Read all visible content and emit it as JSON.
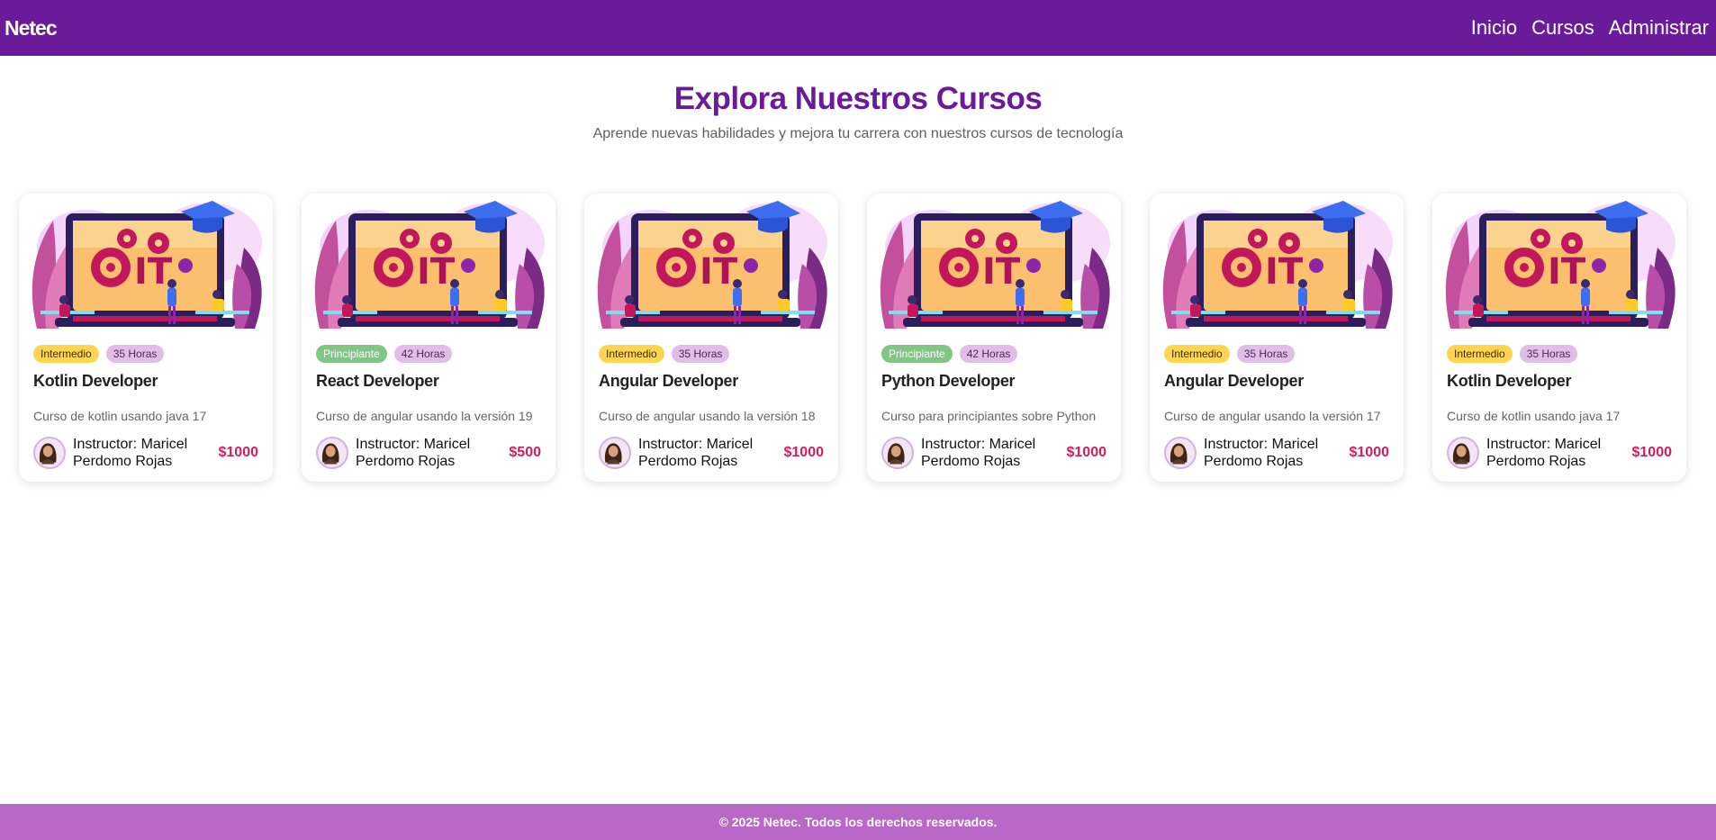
{
  "nav": {
    "brand": "Netec",
    "links": [
      "Inicio",
      "Cursos",
      "Administrar"
    ]
  },
  "hero": {
    "title": "Explora Nuestros Cursos",
    "subtitle": "Aprende nuevas habilidades y mejora tu carrera con nuestros cursos de tecnología"
  },
  "courses": [
    {
      "level": "Intermedio",
      "hours": "35 Horas",
      "title": "Kotlin Developer",
      "description": "Curso de kotlin usando java 17",
      "instructor": "Instructor: Maricel Perdomo Rojas",
      "price": "$1000"
    },
    {
      "level": "Principiante",
      "hours": "42 Horas",
      "title": "React Developer",
      "description": "Curso de angular usando la versión 19",
      "instructor": "Instructor: Maricel Perdomo Rojas",
      "price": "$500"
    },
    {
      "level": "Intermedio",
      "hours": "35 Horas",
      "title": "Angular Developer",
      "description": "Curso de angular usando la versión 18",
      "instructor": "Instructor: Maricel Perdomo Rojas",
      "price": "$1000"
    },
    {
      "level": "Principiante",
      "hours": "42 Horas",
      "title": "Python Developer",
      "description": "Curso para principiantes sobre Python",
      "instructor": "Instructor: Maricel Perdomo Rojas",
      "price": "$1000"
    },
    {
      "level": "Intermedio",
      "hours": "35 Horas",
      "title": "Angular Developer",
      "description": "Curso de angular usando la versión 17",
      "instructor": "Instructor: Maricel Perdomo Rojas",
      "price": "$1000"
    },
    {
      "level": "Intermedio",
      "hours": "35 Horas",
      "title": "Kotlin Developer",
      "description": "Curso de kotlin usando java 17",
      "instructor": "Instructor: Maricel Perdomo Rojas",
      "price": "$1000"
    }
  ],
  "illustration": {
    "text": "IT"
  },
  "footer": {
    "text": "© 2025 Netec. Todos los derechos reservados."
  },
  "colors": {
    "primary": "#6a1b9a",
    "footer": "#ba68c8",
    "price": "#d81b60",
    "intermedio": "#ffd54f",
    "principiante": "#81c784",
    "hours": "#e1bee7"
  }
}
